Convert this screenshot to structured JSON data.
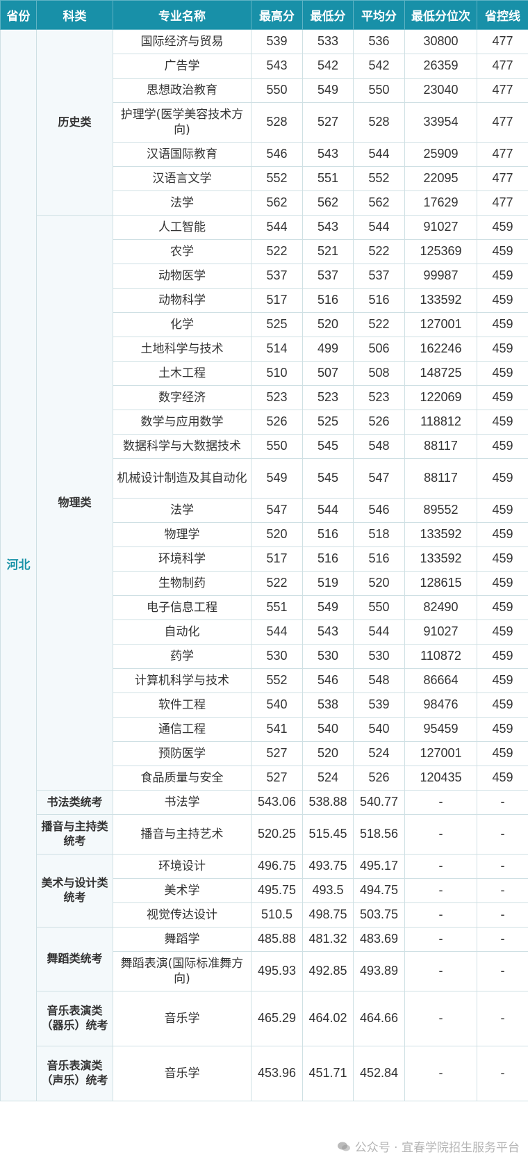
{
  "headers": [
    "省份",
    "科类",
    "专业名称",
    "最高分",
    "最低分",
    "平均分",
    "最低分位次",
    "省控线"
  ],
  "province": "河北",
  "groups": [
    {
      "category": "历史类",
      "rows": [
        [
          "国际经济与贸易",
          "539",
          "533",
          "536",
          "30800",
          "477"
        ],
        [
          "广告学",
          "543",
          "542",
          "542",
          "26359",
          "477"
        ],
        [
          "思想政治教育",
          "550",
          "549",
          "550",
          "23040",
          "477"
        ],
        [
          "护理学(医学美容技术方向)",
          "528",
          "527",
          "528",
          "33954",
          "477"
        ],
        [
          "汉语国际教育",
          "546",
          "543",
          "544",
          "25909",
          "477"
        ],
        [
          "汉语言文学",
          "552",
          "551",
          "552",
          "22095",
          "477"
        ],
        [
          "法学",
          "562",
          "562",
          "562",
          "17629",
          "477"
        ]
      ]
    },
    {
      "category": "物理类",
      "rows": [
        [
          "人工智能",
          "544",
          "543",
          "544",
          "91027",
          "459"
        ],
        [
          "农学",
          "522",
          "521",
          "522",
          "125369",
          "459"
        ],
        [
          "动物医学",
          "537",
          "537",
          "537",
          "99987",
          "459"
        ],
        [
          "动物科学",
          "517",
          "516",
          "516",
          "133592",
          "459"
        ],
        [
          "化学",
          "525",
          "520",
          "522",
          "127001",
          "459"
        ],
        [
          "土地科学与技术",
          "514",
          "499",
          "506",
          "162246",
          "459"
        ],
        [
          "土木工程",
          "510",
          "507",
          "508",
          "148725",
          "459"
        ],
        [
          "数字经济",
          "523",
          "523",
          "523",
          "122069",
          "459"
        ],
        [
          "数学与应用数学",
          "526",
          "525",
          "526",
          "118812",
          "459"
        ],
        [
          "数据科学与大数据技术",
          "550",
          "545",
          "548",
          "88117",
          "459"
        ],
        [
          "机械设计制造及其自动化",
          "549",
          "545",
          "547",
          "88117",
          "459"
        ],
        [
          "法学",
          "547",
          "544",
          "546",
          "89552",
          "459"
        ],
        [
          "物理学",
          "520",
          "516",
          "518",
          "133592",
          "459"
        ],
        [
          "环境科学",
          "517",
          "516",
          "516",
          "133592",
          "459"
        ],
        [
          "生物制药",
          "522",
          "519",
          "520",
          "128615",
          "459"
        ],
        [
          "电子信息工程",
          "551",
          "549",
          "550",
          "82490",
          "459"
        ],
        [
          "自动化",
          "544",
          "543",
          "544",
          "91027",
          "459"
        ],
        [
          "药学",
          "530",
          "530",
          "530",
          "110872",
          "459"
        ],
        [
          "计算机科学与技术",
          "552",
          "546",
          "548",
          "86664",
          "459"
        ],
        [
          "软件工程",
          "540",
          "538",
          "539",
          "98476",
          "459"
        ],
        [
          "通信工程",
          "541",
          "540",
          "540",
          "95459",
          "459"
        ],
        [
          "预防医学",
          "527",
          "520",
          "524",
          "127001",
          "459"
        ],
        [
          "食品质量与安全",
          "527",
          "524",
          "526",
          "120435",
          "459"
        ]
      ]
    },
    {
      "category": "书法类统考",
      "rows": [
        [
          "书法学",
          "543.06",
          "538.88",
          "540.77",
          "-",
          "-"
        ]
      ]
    },
    {
      "category": "播音与主持类统考",
      "rows": [
        [
          "播音与主持艺术",
          "520.25",
          "515.45",
          "518.56",
          "-",
          "-"
        ]
      ]
    },
    {
      "category": "美术与设计类统考",
      "rows": [
        [
          "环境设计",
          "496.75",
          "493.75",
          "495.17",
          "-",
          "-"
        ],
        [
          "美术学",
          "495.75",
          "493.5",
          "494.75",
          "-",
          "-"
        ],
        [
          "视觉传达设计",
          "510.5",
          "498.75",
          "503.75",
          "-",
          "-"
        ]
      ]
    },
    {
      "category": "舞蹈类统考",
      "rows": [
        [
          "舞蹈学",
          "485.88",
          "481.32",
          "483.69",
          "-",
          "-"
        ],
        [
          "舞蹈表演(国际标准舞方向)",
          "495.93",
          "492.85",
          "493.89",
          "-",
          "-"
        ]
      ]
    },
    {
      "category": "音乐表演类（器乐）统考",
      "rows": [
        [
          "音乐学",
          "465.29",
          "464.02",
          "464.66",
          "-",
          "-"
        ]
      ]
    },
    {
      "category": "音乐表演类（声乐）统考",
      "rows": [
        [
          "音乐学",
          "453.96",
          "451.71",
          "452.84",
          "-",
          "-"
        ]
      ]
    }
  ],
  "watermark": "公众号 · 宜春学院招生服务平台",
  "colors": {
    "header_bg": "#1890a8",
    "province_text": "#1a93a8",
    "border": "#cfe0e4"
  }
}
